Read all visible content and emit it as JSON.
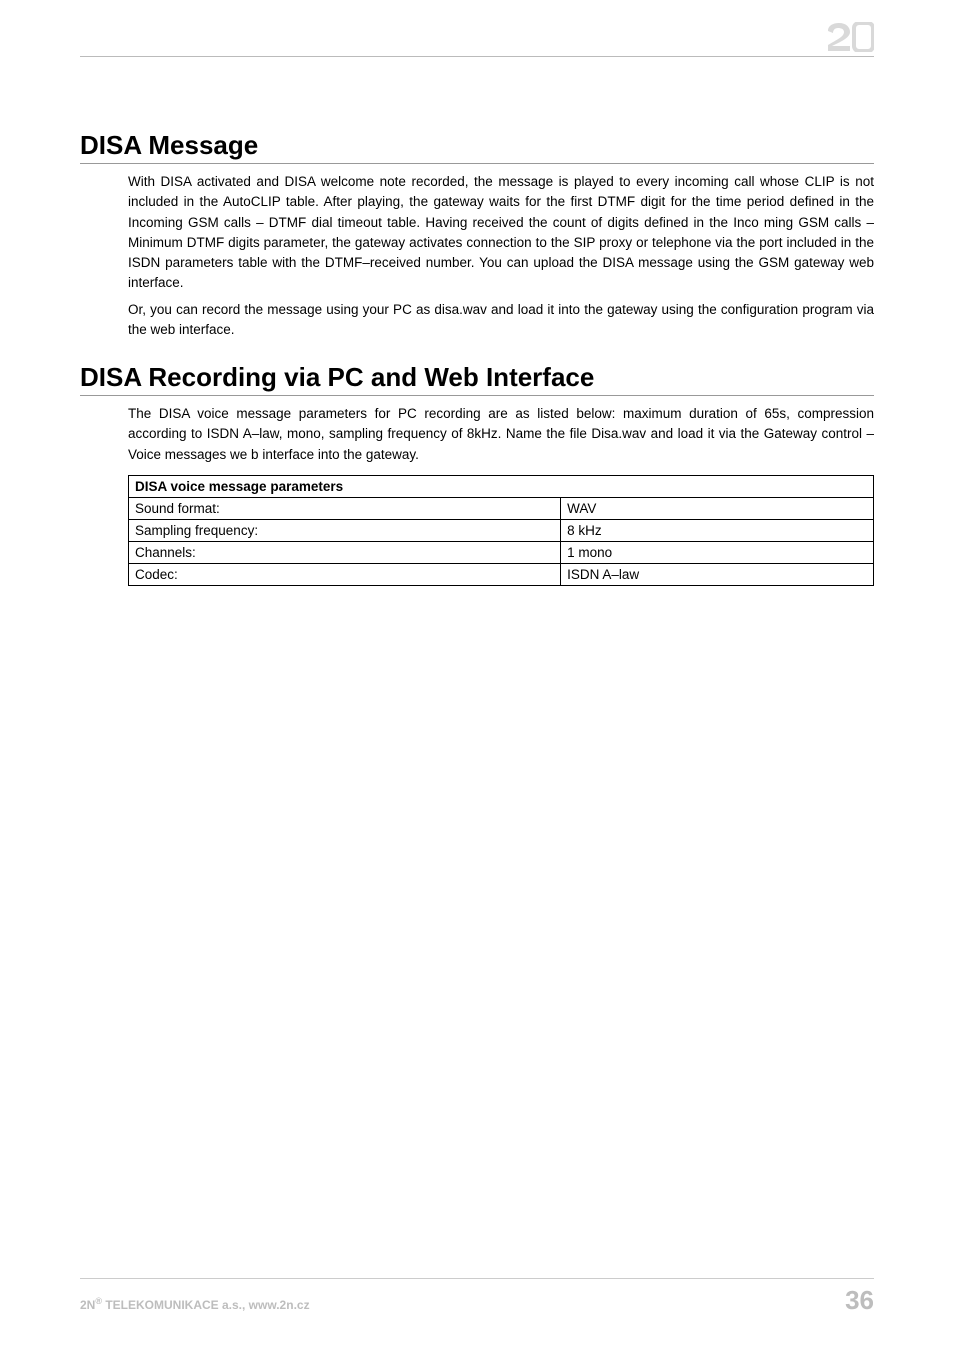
{
  "section1": {
    "heading": "DISA Message",
    "para1": "With DISA activated and DISA welcome note recorded, the message is played to every incoming call whose CLIP is not included in the AutoCLIP table. After playing, the gateway waits for the first DTMF digit for the time period defined in the Incoming GSM calls – DTMF dial timeout table. Having received the count of digits defined in the Inco ming GSM calls – Minimum DTMF digits parameter, the gateway activates connection to the SIP proxy or telephone via the port included in the ISDN parameters table with the DTMF–received number. You can upload the DISA message using the GSM gateway web interface.",
    "para2": "Or, you can record the message using your PC as disa.wav and load it into the gateway using the configuration program via the web interface."
  },
  "section2": {
    "heading": "DISA Recording via PC and Web Interface",
    "para1": "The DISA voice message parameters for PC recording are as listed below: maximum duration of 65s, compression according to ISDN A–law, mono, sampling frequency of 8kHz. Name the file Disa.wav and load it via the Gateway control – Voice messages we b interface into the gateway."
  },
  "table": {
    "header": "DISA voice message parameters",
    "rows": [
      {
        "label": "Sound format:",
        "value": "WAV"
      },
      {
        "label": "Sampling frequency:",
        "value": "8 kHz"
      },
      {
        "label": "Channels:",
        "value": "1 mono"
      },
      {
        "label": "Codec:",
        "value": "ISDN A–law"
      }
    ]
  },
  "footer": {
    "left_prefix": "2N",
    "left_sup": "®",
    "left_suffix": " TELEKOMUNIKACE a.s., www.2n.cz",
    "page": "36"
  }
}
